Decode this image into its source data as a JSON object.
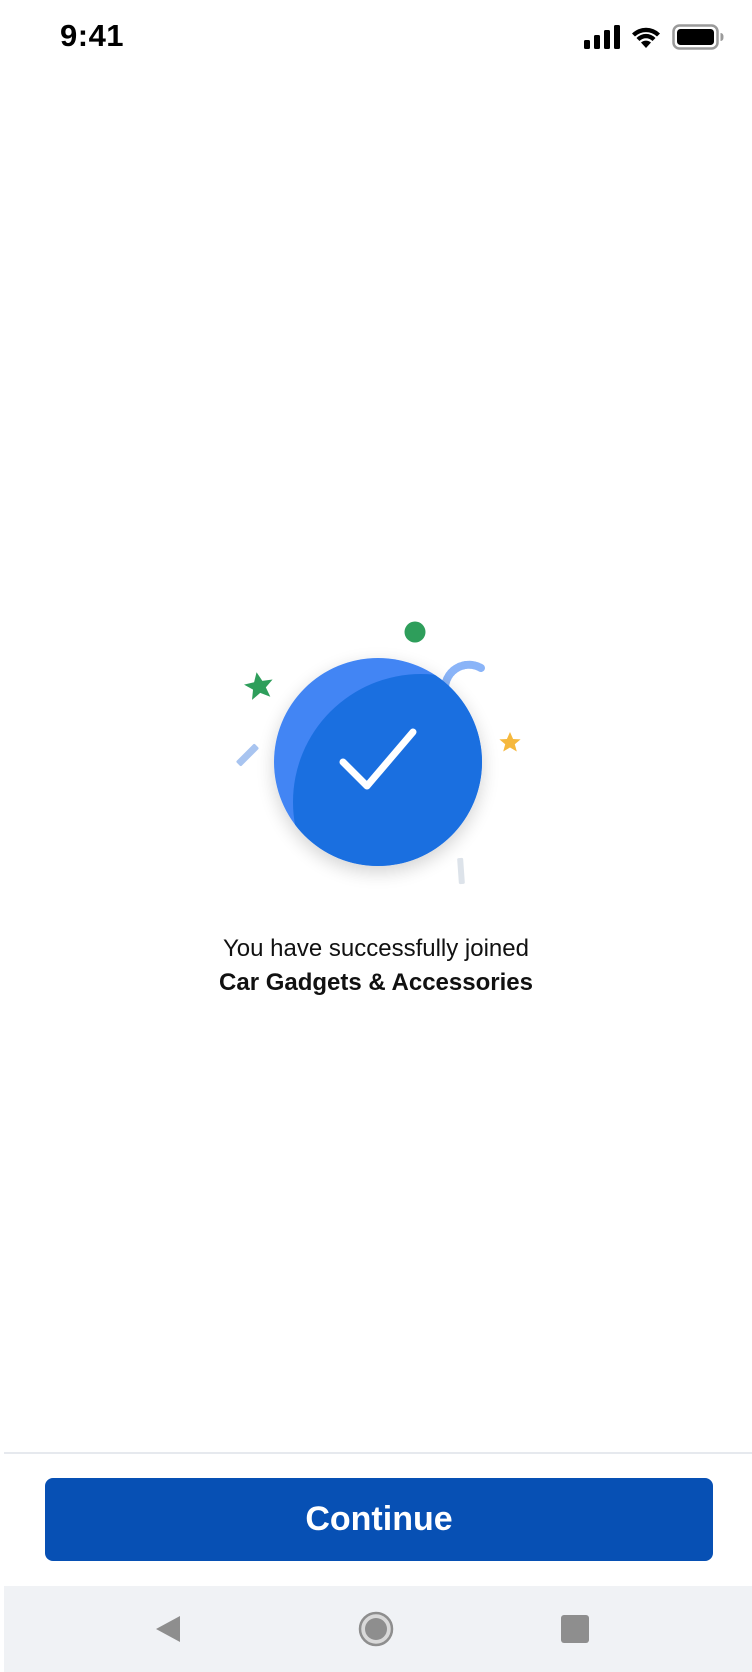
{
  "status_bar": {
    "time": "9:41",
    "icons": [
      "signal-icon",
      "wifi-icon",
      "battery-icon"
    ]
  },
  "illustration": {
    "icon": "checkmark-icon",
    "colors": {
      "circle_outer": "#4285f4",
      "circle_inner": "#1a6fe0",
      "dot_green": "#2e9e5b",
      "star_green": "#2e9e5b",
      "star_yellow": "#f5b83d",
      "arc_blue": "#8ab4f8",
      "confetti_blue": "#a8c4f0",
      "confetti_gray": "#dde3ea"
    }
  },
  "message": {
    "line1": "You have successfully joined",
    "group_name": "Car Gadgets & Accessories"
  },
  "footer": {
    "continue_label": "Continue",
    "button_color": "#0750b4"
  },
  "nav_bar": {
    "items": [
      "back-icon",
      "home-icon",
      "recents-icon"
    ]
  }
}
